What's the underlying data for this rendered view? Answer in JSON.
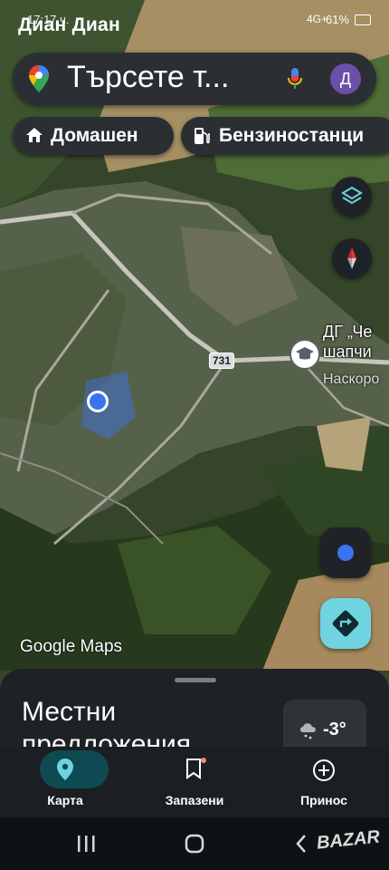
{
  "status_bar": {
    "time": "17:17 ч.",
    "contact_name": "Диан Диан",
    "signal_text": "4G+",
    "battery": "61%"
  },
  "search": {
    "placeholder": "Търсете т...",
    "avatar_letter": "Д"
  },
  "chips": [
    {
      "label": "Домашен",
      "icon": "home-icon"
    },
    {
      "label": "Бензиностанци",
      "icon": "gas-station-icon"
    }
  ],
  "map": {
    "road_label": "731",
    "poi_title_1": "ДГ „Че",
    "poi_title_2": "шапчи",
    "poi_subtitle": "Наскоро",
    "attribution": "Google Maps"
  },
  "sheet": {
    "title": "Местни предложения",
    "weather_temp": "-3°"
  },
  "bottom_nav": [
    {
      "label": "Карта",
      "icon": "explore-pin-icon",
      "active": true
    },
    {
      "label": "Запазени",
      "icon": "bookmark-icon",
      "active": false
    },
    {
      "label": "Принос",
      "icon": "add-circle-icon",
      "active": false
    }
  ],
  "watermark": "BAZAR",
  "colors": {
    "accent": "#0e4a52",
    "directions": "#6fd4e0",
    "location_dot": "#3b73f0",
    "avatar": "#6c4fa8"
  }
}
